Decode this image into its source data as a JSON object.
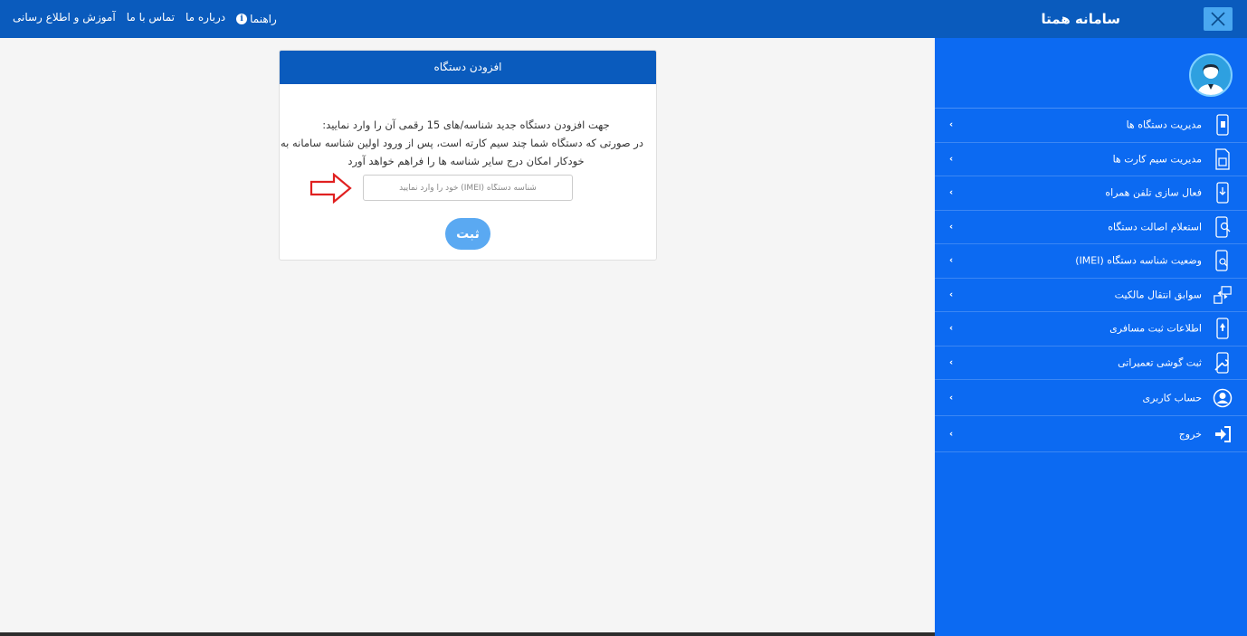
{
  "topbar": {
    "links": [
      "راهنما",
      "درباره ما",
      "تماس با ما",
      "آموزش و اطلاع رسانی"
    ],
    "brand": "سامانه همتا",
    "help_icon": "info-icon",
    "close_icon": "close-icon"
  },
  "sidebar": {
    "avatar_icon": "user-avatar-icon",
    "items": [
      {
        "label": "مدیریت دستگاه ها",
        "icon": "phone-manage-icon"
      },
      {
        "label": "مدیریت سیم کارت ها",
        "icon": "sim-card-icon"
      },
      {
        "label": "فعال سازی تلفن همراه",
        "icon": "phone-activate-icon"
      },
      {
        "label": "استعلام اصالت دستگاه",
        "icon": "phone-search-icon"
      },
      {
        "label": "وضعیت شناسه دستگاه (IMEI)",
        "icon": "phone-status-icon"
      },
      {
        "label": "سوابق انتقال مالکیت",
        "icon": "transfer-icon"
      },
      {
        "label": "اطلاعات ثبت مسافری",
        "icon": "travel-phone-icon"
      },
      {
        "label": "ثبت گوشی تعمیراتی",
        "icon": "repair-icon"
      },
      {
        "label": "حساب کاربری",
        "icon": "user-account-icon"
      },
      {
        "label": "خروج",
        "icon": "logout-icon"
      }
    ],
    "chevron": "‹"
  },
  "card": {
    "title": "افزودن دستگاه",
    "line1": "جهت افزودن دستگاه جدید شناسه/های 15 رقمی آن را وارد نمایید:",
    "line2": "در صورتی که دستگاه شما چند سیم کارته است، پس از ورود اولین شناسه سامانه به طور",
    "line3": "خودکار امکان درج سایر شناسه ها را فراهم خواهد آورد",
    "input_placeholder": "شناسه دستگاه (IMEI) خود را وارد نمایید",
    "input_value": "",
    "submit_label": "ثبت"
  },
  "colors": {
    "header": "#0a5bbd",
    "sidebar": "#0c6af2",
    "button": "#5aa9f2",
    "arrow": "#e02020"
  }
}
